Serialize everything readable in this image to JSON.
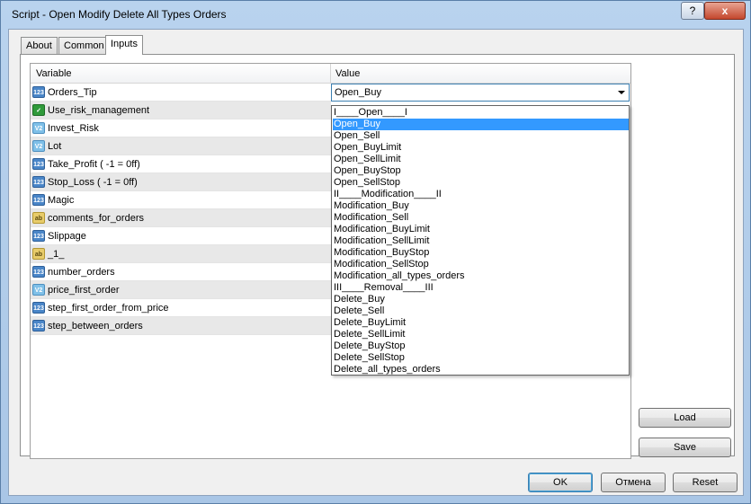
{
  "window": {
    "title": "Script - Open Modify Delete All Types Orders",
    "help_glyph": "?",
    "close_glyph": "x"
  },
  "tabs": [
    {
      "label": "About"
    },
    {
      "label": "Common"
    },
    {
      "label": "Inputs"
    }
  ],
  "grid": {
    "columns": {
      "variable": "Variable",
      "value": "Value"
    },
    "rows": [
      {
        "name": "Orders_Tip",
        "icon": "int-type-icon",
        "badge": "123"
      },
      {
        "name": "Use_risk_management",
        "icon": "bool-type-icon",
        "badge": "✓"
      },
      {
        "name": "Invest_Risk",
        "icon": "double-type-icon",
        "badge": "V2"
      },
      {
        "name": "Lot",
        "icon": "double-type-icon",
        "badge": "V2"
      },
      {
        "name": "Take_Profit ( -1 = 0ff)",
        "icon": "int-type-icon",
        "badge": "123"
      },
      {
        "name": "Stop_Loss ( -1 = 0ff)",
        "icon": "int-type-icon",
        "badge": "123"
      },
      {
        "name": "Magic",
        "icon": "int-type-icon",
        "badge": "123"
      },
      {
        "name": "comments_for_orders",
        "icon": "string-type-icon",
        "badge": "ab"
      },
      {
        "name": "Slippage",
        "icon": "int-type-icon",
        "badge": "123"
      },
      {
        "name": "_1_",
        "icon": "string-type-icon",
        "badge": "ab"
      },
      {
        "name": "number_orders",
        "icon": "int-type-icon",
        "badge": "123"
      },
      {
        "name": "price_first_order",
        "icon": "double-type-icon",
        "badge": "V2"
      },
      {
        "name": "step_first_order_from_price",
        "icon": "int-type-icon",
        "badge": "123"
      },
      {
        "name": "step_between_orders",
        "icon": "int-type-icon",
        "badge": "123"
      }
    ],
    "selected_value": "Open_Buy"
  },
  "dropdown": {
    "highlighted": "Open_Buy",
    "options": [
      "I____Open____I",
      "Open_Buy",
      "Open_Sell",
      "Open_BuyLimit",
      "Open_SellLimit",
      "Open_BuyStop",
      "Open_SellStop",
      "II____Modification____II",
      "Modification_Buy",
      "Modification_Sell",
      "Modification_BuyLimit",
      "Modification_SellLimit",
      "Modification_BuyStop",
      "Modification_SellStop",
      "Modification_all_types_orders",
      "III____Removal____III",
      "Delete_Buy",
      "Delete_Sell",
      "Delete_BuyLimit",
      "Delete_SellLimit",
      "Delete_BuyStop",
      "Delete_SellStop",
      "Delete_all_types_orders"
    ]
  },
  "side_buttons": {
    "load": "Load",
    "save": "Save"
  },
  "footer": {
    "ok": "OK",
    "cancel": "Отмена",
    "reset": "Reset"
  }
}
